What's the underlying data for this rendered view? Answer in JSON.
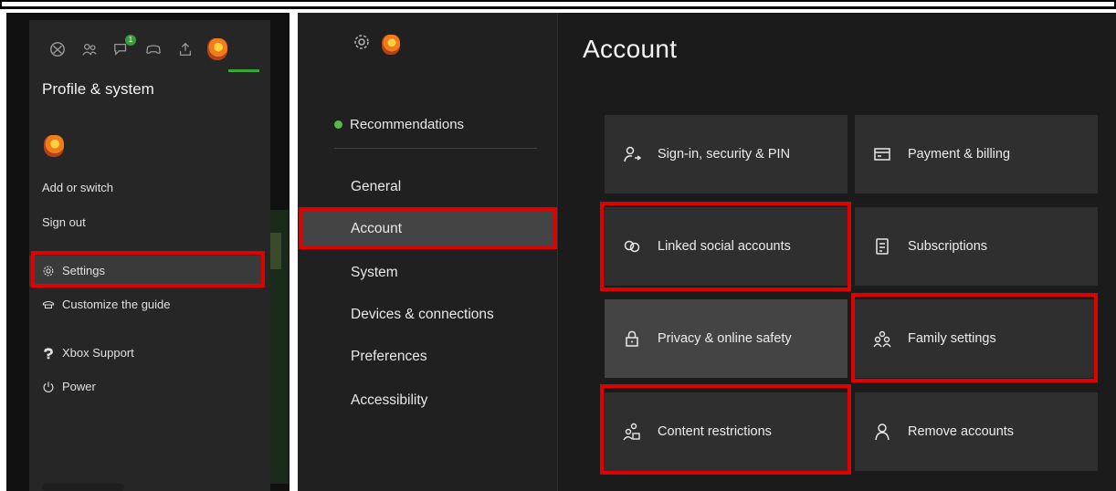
{
  "guide": {
    "title": "Profile & system",
    "tabs": [
      {
        "icon": "xbox-icon"
      },
      {
        "icon": "people-icon"
      },
      {
        "icon": "chat-icon",
        "badge": "1"
      },
      {
        "icon": "controller-icon"
      },
      {
        "icon": "upload-icon"
      },
      {
        "icon": "avatar-icon"
      }
    ],
    "items": {
      "add_or_switch": "Add or switch",
      "sign_out": "Sign out",
      "settings": "Settings",
      "customize_guide": "Customize the guide",
      "xbox_support": "Xbox Support",
      "power": "Power"
    }
  },
  "settings": {
    "nav": {
      "recommendations": "Recommendations",
      "items": [
        "General",
        "Account",
        "System",
        "Devices & connections",
        "Preferences",
        "Accessibility"
      ],
      "selected": "Account"
    },
    "title": "Account",
    "tiles": [
      {
        "label": "Sign-in, security & PIN",
        "icon": "person-key-icon"
      },
      {
        "label": "Payment & billing",
        "icon": "card-icon"
      },
      {
        "label": "Linked social accounts",
        "icon": "link-icon"
      },
      {
        "label": "Subscriptions",
        "icon": "receipt-icon"
      },
      {
        "label": "Privacy & online safety",
        "icon": "lock-icon"
      },
      {
        "label": "Family settings",
        "icon": "family-icon"
      },
      {
        "label": "Content restrictions",
        "icon": "person-lock-icon"
      },
      {
        "label": "Remove accounts",
        "icon": "person-icon"
      }
    ]
  },
  "colors": {
    "accent_green": "#3aa537",
    "highlight_red": "#e00000",
    "panel_bg": "#262626",
    "tile_bg": "#2f2f2f"
  }
}
